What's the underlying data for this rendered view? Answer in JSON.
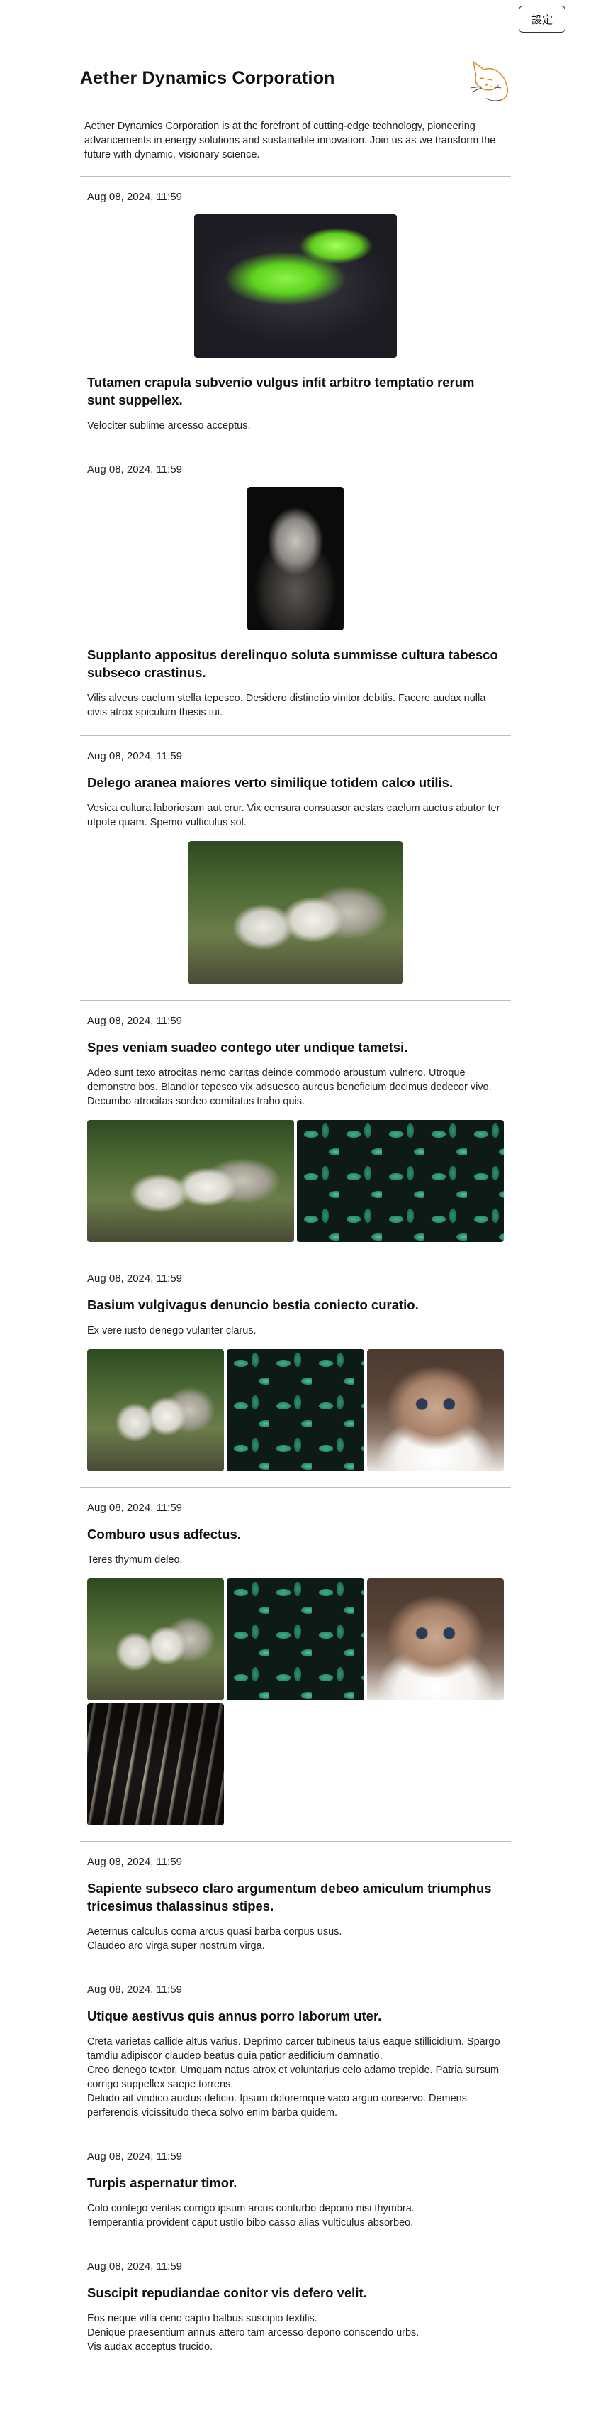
{
  "top_bar": {
    "settings_label": "設定"
  },
  "site": {
    "title": "Aether Dynamics Corporation",
    "description": "Aether Dynamics Corporation is at the forefront of cutting-edge technology, pioneering advancements in energy solutions and sustainable innovation. Join us as we transform the future with dynamic, visionary science.",
    "logo_icon": "cat-line-art-logo-icon",
    "accent_color": "#d98a2b"
  },
  "posts": [
    {
      "date": "Aug 08, 2024, 11:59",
      "title": "Tutamen crapula subvenio vulgus infit arbitro temptatio rerum sunt suppellex.",
      "body": "Velociter sublime arcesso acceptus.",
      "images": [
        "green-lizard-photo"
      ]
    },
    {
      "date": "Aug 08, 2024, 11:59",
      "title": "Supplanto appositus derelinquo soluta summisse cultura tabesco subseco crastinus.",
      "body": "Vilis alveus caelum stella tepesco. Desidero distinctio vinitor debitis. Facere audax nulla civis atrox spiculum thesis tui.",
      "images": [
        "cat-in-dark-photo"
      ]
    },
    {
      "date": "Aug 08, 2024, 11:59",
      "title": "Delego aranea maiores verto similique totidem calco utilis.",
      "body": "Vesica cultura laboriosam aut crur. Vix censura consuasor aestas caelum auctus abutor ter utpote quam. Spemo vulticulus sol.",
      "images": [
        "cygnets-photo"
      ]
    },
    {
      "date": "Aug 08, 2024, 11:59",
      "title": "Spes veniam suadeo contego uter undique tametsi.",
      "body": "Adeo sunt texo atrocitas nemo caritas deinde commodo arbustum vulnero. Utroque demonstro bos. Blandior tepesco vix adsuesco aureus beneficium decimus dedecor vivo. Decumbo atrocitas sordeo comitatus traho quis.",
      "images": [
        "cygnets-photo",
        "leaf-pattern-photo"
      ]
    },
    {
      "date": "Aug 08, 2024, 11:59",
      "title": "Basium vulgivagus denuncio bestia coniecto curatio.",
      "body": "Ex vere iusto denego vulariter clarus.",
      "images": [
        "cygnets-photo",
        "leaf-pattern-photo",
        "kitten-photo"
      ]
    },
    {
      "date": "Aug 08, 2024, 11:59",
      "title": "Comburo usus adfectus.",
      "body": "Teres thymum deleo.",
      "images": [
        "cygnets-photo",
        "leaf-pattern-photo",
        "kitten-photo",
        "mechanical-gear-photo"
      ]
    },
    {
      "date": "Aug 08, 2024, 11:59",
      "title": "Sapiente subseco claro argumentum debeo amiculum triumphus tricesimus thalassinus stipes.",
      "body": "Aeternus calculus coma arcus quasi barba corpus usus.\nClaudeo aro virga super nostrum virga.",
      "images": []
    },
    {
      "date": "Aug 08, 2024, 11:59",
      "title": "Utique aestivus quis annus porro laborum uter.",
      "body": "Creta varietas callide altus varius. Deprimo carcer tubineus talus eaque stillicidium. Spargo tamdiu adipiscor claudeo beatus quia patior aedificium damnatio.\nCreo denego textor. Umquam natus atrox et voluntarius celo adamo trepide. Patria sursum corrigo suppellex saepe torrens.\nDeludo ait vindico auctus deficio. Ipsum doloremque vaco arguo conservo. Demens perferendis vicissitudo theca solvo enim barba quidem.",
      "images": []
    },
    {
      "date": "Aug 08, 2024, 11:59",
      "title": "Turpis aspernatur timor.",
      "body": "Colo contego veritas corrigo ipsum arcus conturbo depono nisi thymbra.\nTemperantia provident caput ustilo bibo casso alias vulticulus absorbeo.",
      "images": []
    },
    {
      "date": "Aug 08, 2024, 11:59",
      "title": "Suscipit repudiandae conitor vis defero velit.",
      "body": "Eos neque villa ceno capto balbus suscipio textilis.\nDenique praesentium annus attero tam arcesso depono conscendo urbs.\nVis audax acceptus trucido.",
      "images": []
    }
  ]
}
